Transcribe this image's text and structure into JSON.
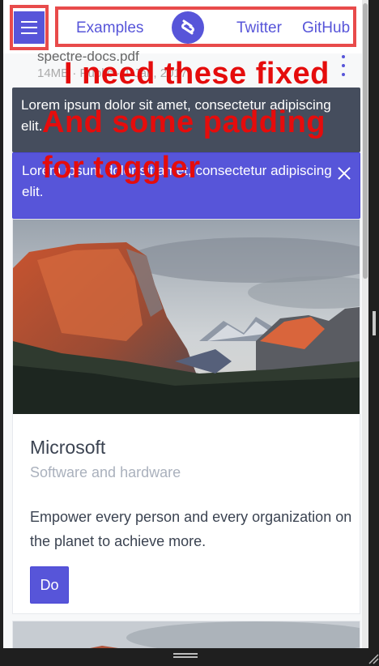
{
  "nav": {
    "links": [
      "Examples",
      "Twitter",
      "GitHub"
    ],
    "logo_icon": "spectre-logo-icon",
    "menu_icon": "hamburger-menu-icon"
  },
  "file": {
    "name": "spectre-docs.pdf",
    "meta": "14MB · Public · 1 Jan, 2017"
  },
  "toasts": [
    {
      "text": "Lorem ipsum dolor sit amet, consectetur adipiscing elit.",
      "style": "dark"
    },
    {
      "text": "Lorem ipsum dolor sit amet, consectetur adipiscing elit.",
      "style": "primary",
      "close_icon": "close-icon"
    }
  ],
  "card": {
    "title": "Microsoft",
    "subtitle": "Software and hardware",
    "body": "Empower every person and every organization on the planet to achieve more.",
    "button": "Do"
  },
  "annotations": [
    "I need these fixed",
    "And some padding",
    "for toggler"
  ],
  "colors": {
    "primary": "#5755d9",
    "annotation_red": "#e50c0c",
    "highlight_border": "#e84b4b",
    "toast_dark": "#454d5d"
  }
}
